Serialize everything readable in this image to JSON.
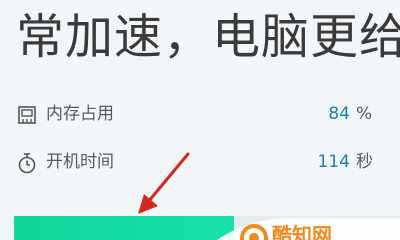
{
  "headline": "常加速，电脑更给",
  "stats": {
    "memory": {
      "icon": "memory-chip-icon",
      "label": "内存占用",
      "value": "84",
      "unit": "%"
    },
    "boot": {
      "icon": "stopwatch-icon",
      "label": "开机时间",
      "value": "114",
      "unit": "秒"
    }
  },
  "progress": {
    "fill_fraction": 0.57,
    "color": "#14d59a"
  },
  "colors": {
    "accent_value": "#1b7fb8",
    "arrow": "#d3261e",
    "text": "#3a3a3a"
  },
  "watermark": {
    "text": "酷知网",
    "icon": "watermark-logo-icon"
  }
}
